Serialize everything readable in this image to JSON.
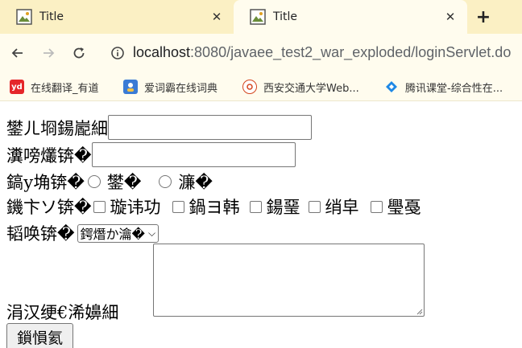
{
  "tabs": [
    {
      "title": "Title",
      "favicon": "image-icon"
    },
    {
      "title": "Title",
      "favicon": "image-icon"
    }
  ],
  "address": {
    "host": "localhost",
    "path": ":8080/javaee_test2_war_exploded/loginServlet.do"
  },
  "bookmarks": [
    {
      "label": "在线翻译_有道",
      "icon_text": "yd",
      "color": "#e5262a"
    },
    {
      "label": "爱词霸在线词典",
      "icon_text": "",
      "color": "#3a7bd5"
    },
    {
      "label": "西安交通大学Web...",
      "icon_text": "",
      "color": "#d4451d"
    },
    {
      "label": "腾讯课堂-综合性在...",
      "icon_text": "",
      "color": "#1e88e5"
    }
  ],
  "form": {
    "username_label": "鐢ㄦ埛鍚嶏細",
    "password_label": "瀵嗙爜锛�",
    "gender_label": "鎬у埆锛�",
    "gender_options": [
      "鐢�",
      "濂�"
    ],
    "hobby_label": "鐖卞ソ锛�",
    "hobbies": [
      "璇讳功",
      "鍋ヨ韩",
      "鍚琧",
      "绡皁",
      "璺戞"
    ],
    "city_label": "韬唤锛�",
    "city_selected": "鍔熸か瀹�",
    "intro_label": "涓汉绠€浠嬶細",
    "submit_label": "鎻愪氦"
  }
}
